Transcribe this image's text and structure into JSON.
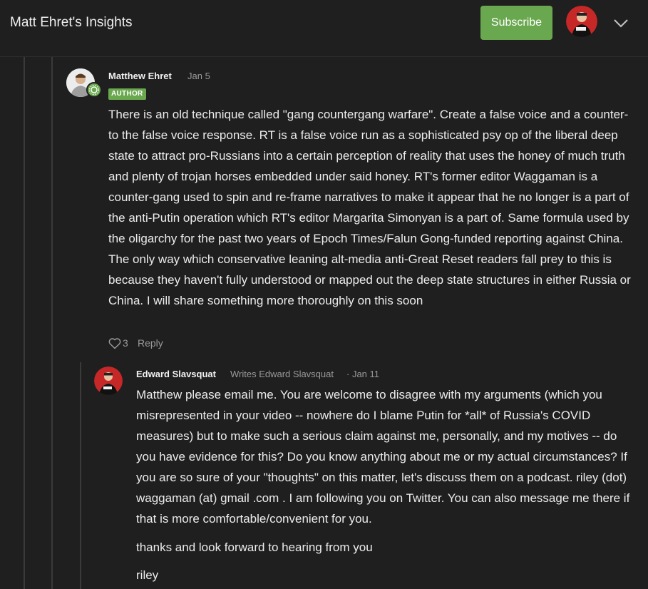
{
  "header": {
    "site_title": "Matt Ehret's Insights",
    "subscribe_label": "Subscribe",
    "accent_color": "#6aa84f",
    "avatar_icon": "user-avatar-icon",
    "menu_icon": "chevron-down-icon"
  },
  "comments": [
    {
      "author": "Matthew Ehret",
      "date": "Jan 5",
      "badge": "AUTHOR",
      "body": "There is an old technique called \"gang countergang warfare\". Create a false voice and a counter-to the false voice response. RT is a false voice run as a sophisticated psy op of the liberal deep state to attract pro-Russians into a certain perception of reality that uses the honey of much truth and plenty of trojan horses embedded under said honey. RT's former editor Waggaman is a counter-gang used to spin and re-frame narratives to make it appear that he no longer is a part of the anti-Putin operation which RT's editor Margarita Simonyan is a part of. Same formula used by the oligarchy for the past two years of Epoch Times/Falun Gong-funded reporting against China. The only way which conservative leaning alt-media anti-Great Reset readers fall prey to this is because they haven't fully understood or mapped out the deep state structures in either Russia or China. I will share something more thoroughly on this soon",
      "likes": "3",
      "reply_label": "Reply"
    },
    {
      "author": "Edward Slavsquat",
      "writes": "Writes Edward Slavsquat",
      "date": "· Jan 11",
      "paragraphs": [
        "Matthew please email me. You are welcome to disagree with my arguments (which you misrepresented in your video -- nowhere do I blame Putin for *all* of Russia's COVID measures) but to make such a serious claim against me, personally, and my motives -- do you have evidence for this? Do you know anything about me or my actual circumstances? If you are so sure of your \"thoughts\" on this matter, let's discuss them on a podcast. riley (dot) waggaman (at) gmail .com . I am following you on Twitter. You can also message me there if that is more comfortable/convenient for you.",
        "thanks and look forward to hearing from you",
        "riley"
      ]
    }
  ]
}
